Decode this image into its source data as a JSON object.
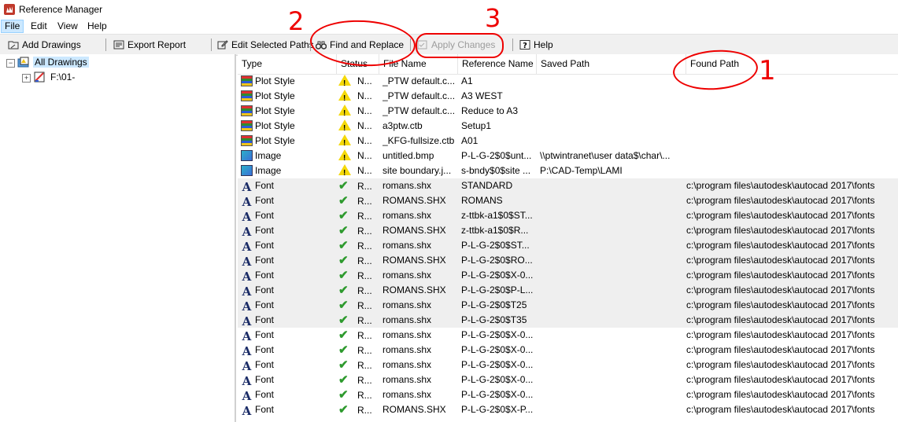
{
  "window": {
    "title": "Reference Manager"
  },
  "menu": [
    {
      "label": "File"
    },
    {
      "label": "Edit"
    },
    {
      "label": "View"
    },
    {
      "label": "Help"
    }
  ],
  "toolbar": {
    "add_drawings": "Add Drawings",
    "export_report": "Export Report",
    "edit_selected_paths": "Edit Selected Paths",
    "find_and_replace": "Find and Replace",
    "apply_changes": "Apply Changes",
    "help": "Help"
  },
  "tree": {
    "root": "All Drawings",
    "child": "F:\\01-"
  },
  "table": {
    "columns": [
      "Type",
      "Status",
      "File Name",
      "Reference Name",
      "Saved Path",
      "Found Path"
    ],
    "rows": [
      {
        "type": "Plot Style",
        "icon": "plot-style-icon",
        "status": "N...",
        "status_icon": "warning-icon",
        "file": "_PTW default.c...",
        "ref": "A1",
        "saved": "",
        "found": ""
      },
      {
        "type": "Plot Style",
        "icon": "plot-style-icon",
        "status": "N...",
        "status_icon": "warning-icon",
        "file": "_PTW default.c...",
        "ref": "A3 WEST",
        "saved": "",
        "found": ""
      },
      {
        "type": "Plot Style",
        "icon": "plot-style-icon",
        "status": "N...",
        "status_icon": "warning-icon",
        "file": "_PTW default.c...",
        "ref": "Reduce to A3",
        "saved": "",
        "found": ""
      },
      {
        "type": "Plot Style",
        "icon": "plot-style-icon",
        "status": "N...",
        "status_icon": "warning-icon",
        "file": "a3ptw.ctb",
        "ref": "Setup1",
        "saved": "",
        "found": ""
      },
      {
        "type": "Plot Style",
        "icon": "plot-style-icon",
        "status": "N...",
        "status_icon": "warning-icon",
        "file": "_KFG-fullsize.ctb",
        "ref": "A01",
        "saved": "",
        "found": ""
      },
      {
        "type": "Image",
        "icon": "image-icon",
        "status": "N...",
        "status_icon": "warning-icon",
        "file": "untitled.bmp",
        "ref": "P-L-G-2$0$unt...",
        "saved": "\\\\ptwintranet\\user data$\\char\\...",
        "found": ""
      },
      {
        "type": "Image",
        "icon": "image-icon",
        "status": "N...",
        "status_icon": "warning-icon",
        "file": "site boundary.j...",
        "ref": "s-bndy$0$site ...",
        "saved": "P:\\CAD-Temp\\LAMI",
        "found": ""
      },
      {
        "type": "Font",
        "icon": "font-icon",
        "status": "R...",
        "status_icon": "check-icon",
        "file": "romans.shx",
        "ref": "STANDARD",
        "saved": "",
        "found": "c:\\program files\\autodesk\\autocad 2017\\fonts",
        "gray": true
      },
      {
        "type": "Font",
        "icon": "font-icon",
        "status": "R...",
        "status_icon": "check-icon",
        "file": "ROMANS.SHX",
        "ref": "ROMANS",
        "saved": "",
        "found": "c:\\program files\\autodesk\\autocad 2017\\fonts",
        "gray": true
      },
      {
        "type": "Font",
        "icon": "font-icon",
        "status": "R...",
        "status_icon": "check-icon",
        "file": "romans.shx",
        "ref": "z-ttbk-a1$0$ST...",
        "saved": "",
        "found": "c:\\program files\\autodesk\\autocad 2017\\fonts",
        "gray": true
      },
      {
        "type": "Font",
        "icon": "font-icon",
        "status": "R...",
        "status_icon": "check-icon",
        "file": "ROMANS.SHX",
        "ref": "z-ttbk-a1$0$R...",
        "saved": "",
        "found": "c:\\program files\\autodesk\\autocad 2017\\fonts",
        "gray": true
      },
      {
        "type": "Font",
        "icon": "font-icon",
        "status": "R...",
        "status_icon": "check-icon",
        "file": "romans.shx",
        "ref": "P-L-G-2$0$ST...",
        "saved": "",
        "found": "c:\\program files\\autodesk\\autocad 2017\\fonts",
        "gray": true
      },
      {
        "type": "Font",
        "icon": "font-icon",
        "status": "R...",
        "status_icon": "check-icon",
        "file": "ROMANS.SHX",
        "ref": "P-L-G-2$0$RO...",
        "saved": "",
        "found": "c:\\program files\\autodesk\\autocad 2017\\fonts",
        "gray": true
      },
      {
        "type": "Font",
        "icon": "font-icon",
        "status": "R...",
        "status_icon": "check-icon",
        "file": "romans.shx",
        "ref": "P-L-G-2$0$X-0...",
        "saved": "",
        "found": "c:\\program files\\autodesk\\autocad 2017\\fonts",
        "gray": true
      },
      {
        "type": "Font",
        "icon": "font-icon",
        "status": "R...",
        "status_icon": "check-icon",
        "file": "ROMANS.SHX",
        "ref": "P-L-G-2$0$P-L...",
        "saved": "",
        "found": "c:\\program files\\autodesk\\autocad 2017\\fonts",
        "gray": true
      },
      {
        "type": "Font",
        "icon": "font-icon",
        "status": "R...",
        "status_icon": "check-icon",
        "file": "romans.shx",
        "ref": "P-L-G-2$0$T25",
        "saved": "",
        "found": "c:\\program files\\autodesk\\autocad 2017\\fonts",
        "gray": true
      },
      {
        "type": "Font",
        "icon": "font-icon",
        "status": "R...",
        "status_icon": "check-icon",
        "file": "romans.shx",
        "ref": "P-L-G-2$0$T35",
        "saved": "",
        "found": "c:\\program files\\autodesk\\autocad 2017\\fonts",
        "gray": true
      },
      {
        "type": "Font",
        "icon": "font-icon",
        "status": "R...",
        "status_icon": "check-icon",
        "file": "romans.shx",
        "ref": "P-L-G-2$0$X-0...",
        "saved": "",
        "found": "c:\\program files\\autodesk\\autocad 2017\\fonts"
      },
      {
        "type": "Font",
        "icon": "font-icon",
        "status": "R...",
        "status_icon": "check-icon",
        "file": "romans.shx",
        "ref": "P-L-G-2$0$X-0...",
        "saved": "",
        "found": "c:\\program files\\autodesk\\autocad 2017\\fonts"
      },
      {
        "type": "Font",
        "icon": "font-icon",
        "status": "R...",
        "status_icon": "check-icon",
        "file": "romans.shx",
        "ref": "P-L-G-2$0$X-0...",
        "saved": "",
        "found": "c:\\program files\\autodesk\\autocad 2017\\fonts"
      },
      {
        "type": "Font",
        "icon": "font-icon",
        "status": "R...",
        "status_icon": "check-icon",
        "file": "romans.shx",
        "ref": "P-L-G-2$0$X-0...",
        "saved": "",
        "found": "c:\\program files\\autodesk\\autocad 2017\\fonts"
      },
      {
        "type": "Font",
        "icon": "font-icon",
        "status": "R...",
        "status_icon": "check-icon",
        "file": "romans.shx",
        "ref": "P-L-G-2$0$X-0...",
        "saved": "",
        "found": "c:\\program files\\autodesk\\autocad 2017\\fonts"
      },
      {
        "type": "Font",
        "icon": "font-icon",
        "status": "R...",
        "status_icon": "check-icon",
        "file": "ROMANS.SHX",
        "ref": "P-L-G-2$0$X-P...",
        "saved": "",
        "found": "c:\\program files\\autodesk\\autocad 2017\\fonts"
      }
    ]
  },
  "annotations": {
    "one": "1",
    "two": "2",
    "three": "3",
    "color": "#e00000"
  }
}
